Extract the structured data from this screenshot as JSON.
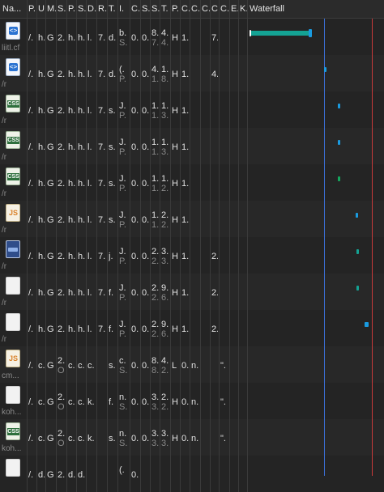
{
  "header": {
    "columns": [
      "Na...",
      "P.",
      "U.",
      "M.",
      "S.",
      "P.",
      "S.",
      "D.",
      "R.",
      "T.",
      "I.",
      "C.",
      "S.",
      "S.",
      "T.",
      "P.",
      "C.",
      "C.",
      "C.",
      "C.",
      "C.",
      "E.",
      "K."
    ],
    "waterfall_label": "Waterfall"
  },
  "colors": {
    "background": "#242424",
    "header": "#2b2b2b",
    "grid": "#3a3a3a",
    "bar_teal": "#14a394",
    "bar_blue": "#1a9be0",
    "bar_green": "#14a85e",
    "dom_content_line": "#3b6fd6",
    "load_line": "#c83a3a"
  },
  "rows": [
    {
      "icon": "html-file-icon",
      "icon_type": "html",
      "icon_glyph": "<>",
      "sub": "liitl.cf",
      "c1": "/.",
      "c2": "h.",
      "c3": "G",
      "c4": "2.",
      "c5": "h.",
      "c6": "h.",
      "c7": "l.",
      "c8": "7.",
      "c9": "d.",
      "c10a": "b.",
      "c10b": "S.",
      "c11": "0.",
      "c12": "0.",
      "c13a": "8.",
      "c13b": "7.",
      "c14a": "4.",
      "c14b": "4.",
      "c15": "H",
      "c16": "1.",
      "c17": "",
      "c18": "",
      "c19": "7.",
      "c20": "",
      "c21": ""
    },
    {
      "icon": "html-file-icon",
      "icon_type": "html",
      "icon_glyph": "<>",
      "sub": "/r",
      "c1": "/.",
      "c2": "h.",
      "c3": "G",
      "c4": "2.",
      "c5": "h.",
      "c6": "h.",
      "c7": "l.",
      "c8": "7.",
      "c9": "d.",
      "c10a": "(.",
      "c10b": "P.",
      "c11": "0.",
      "c12": "0.",
      "c13a": "4.",
      "c13b": "1.",
      "c14a": "1.",
      "c14b": "8.",
      "c15": "H",
      "c16": "1.",
      "c17": "",
      "c18": "",
      "c19": "4.",
      "c20": "",
      "c21": ""
    },
    {
      "icon": "css-file-icon",
      "icon_type": "css",
      "icon_glyph": "CSS",
      "sub": "/r",
      "c1": "/.",
      "c2": "h.",
      "c3": "G",
      "c4": "2.",
      "c5": "h.",
      "c6": "h.",
      "c7": "l.",
      "c8": "7.",
      "c9": "s.",
      "c10a": "J.",
      "c10b": "P.",
      "c11": "0.",
      "c12": "0.",
      "c13a": "1.",
      "c13b": "1.",
      "c14a": "1.",
      "c14b": "3.",
      "c15": "H",
      "c16": "1.",
      "c17": "",
      "c18": "",
      "c19": "",
      "c20": "",
      "c21": ""
    },
    {
      "icon": "css-file-icon",
      "icon_type": "css",
      "icon_glyph": "CSS",
      "sub": "/r",
      "c1": "/.",
      "c2": "h.",
      "c3": "G",
      "c4": "2.",
      "c5": "h.",
      "c6": "h.",
      "c7": "l.",
      "c8": "7.",
      "c9": "s.",
      "c10a": "J.",
      "c10b": "P.",
      "c11": "0.",
      "c12": "0.",
      "c13a": "1.",
      "c13b": "1.",
      "c14a": "1.",
      "c14b": "3.",
      "c15": "H",
      "c16": "1.",
      "c17": "",
      "c18": "",
      "c19": "",
      "c20": "",
      "c21": ""
    },
    {
      "icon": "css-file-icon",
      "icon_type": "css",
      "icon_glyph": "CSS",
      "sub": "/r",
      "c1": "/.",
      "c2": "h.",
      "c3": "G",
      "c4": "2.",
      "c5": "h.",
      "c6": "h.",
      "c7": "l.",
      "c8": "7.",
      "c9": "s.",
      "c10a": "J.",
      "c10b": "P.",
      "c11": "0.",
      "c12": "0.",
      "c13a": "1.",
      "c13b": "1.",
      "c14a": "1.",
      "c14b": "2.",
      "c15": "H",
      "c16": "1.",
      "c17": "",
      "c18": "",
      "c19": "",
      "c20": "",
      "c21": ""
    },
    {
      "icon": "js-file-icon",
      "icon_type": "js",
      "icon_glyph": "JS",
      "sub": "/r",
      "c1": "/.",
      "c2": "h.",
      "c3": "G",
      "c4": "2.",
      "c5": "h.",
      "c6": "h.",
      "c7": "l.",
      "c8": "7.",
      "c9": "s.",
      "c10a": "J.",
      "c10b": "P.",
      "c11": "0.",
      "c12": "0.",
      "c13a": "1.",
      "c13b": "1.",
      "c14a": "2.",
      "c14b": "2.",
      "c15": "H",
      "c16": "1.",
      "c17": "",
      "c18": "",
      "c19": "",
      "c20": "",
      "c21": ""
    },
    {
      "icon": "image-file-icon",
      "icon_type": "img",
      "icon_glyph": "",
      "sub": "/r",
      "c1": "/.",
      "c2": "h.",
      "c3": "G",
      "c4": "2.",
      "c5": "h.",
      "c6": "h.",
      "c7": "l.",
      "c8": "7.",
      "c9": "j.",
      "c10a": "J.",
      "c10b": "P.",
      "c11": "0.",
      "c12": "0.",
      "c13a": "2.",
      "c13b": "2.",
      "c14a": "3.",
      "c14b": "3.",
      "c15": "H",
      "c16": "1.",
      "c17": "",
      "c18": "",
      "c19": "2.",
      "c20": "",
      "c21": ""
    },
    {
      "icon": "blank-file-icon",
      "icon_type": "blank",
      "icon_glyph": "",
      "sub": "/r",
      "c1": "/.",
      "c2": "h.",
      "c3": "G",
      "c4": "2.",
      "c5": "h.",
      "c6": "h.",
      "c7": "l.",
      "c8": "7.",
      "c9": "f.",
      "c10a": "J.",
      "c10b": "P.",
      "c11": "0.",
      "c12": "0.",
      "c13a": "2.",
      "c13b": "2.",
      "c14a": "9.",
      "c14b": "6.",
      "c15": "H",
      "c16": "1.",
      "c17": "",
      "c18": "",
      "c19": "2.",
      "c20": "",
      "c21": ""
    },
    {
      "icon": "blank-file-icon",
      "icon_type": "blank",
      "icon_glyph": "",
      "sub": "/r",
      "c1": "/.",
      "c2": "h.",
      "c3": "G",
      "c4": "2.",
      "c5": "h.",
      "c6": "h.",
      "c7": "l.",
      "c8": "7.",
      "c9": "f.",
      "c10a": "J.",
      "c10b": "P.",
      "c11": "0.",
      "c12": "0.",
      "c13a": "2.",
      "c13b": "2.",
      "c14a": "9.",
      "c14b": "6.",
      "c15": "H",
      "c16": "1.",
      "c17": "",
      "c18": "",
      "c19": "2.",
      "c20": "",
      "c21": ""
    },
    {
      "icon": "js-file-icon",
      "icon_type": "js",
      "icon_glyph": "JS",
      "sub": "cm...",
      "c1": "/.",
      "c2": "c.",
      "c3": "G",
      "c4": "2.",
      "c4b": "O",
      "c5": "c.",
      "c6": "c.",
      "c7": "c.",
      "c8": "",
      "c9": "s.",
      "c10a": "c.",
      "c10b": "S.",
      "c11": "0.",
      "c12": "0.",
      "c13a": "8.",
      "c13b": "8.",
      "c14a": "4.",
      "c14b": "2.",
      "c15": "L",
      "c16": "0.",
      "c17": "n.",
      "c18": "",
      "c19": "",
      "c20": "\".",
      "c21": ""
    },
    {
      "icon": "blank-file-icon",
      "icon_type": "blank",
      "icon_glyph": "",
      "sub": "koh...",
      "c1": "/.",
      "c2": "c.",
      "c3": "G",
      "c4": "2.",
      "c4b": "O",
      "c5": "c.",
      "c6": "c.",
      "c7": "k.",
      "c8": "",
      "c9": "f.",
      "c10a": "n.",
      "c10b": "S.",
      "c11": "0.",
      "c12": "0.",
      "c13a": "3.",
      "c13b": "3.",
      "c14a": "2.",
      "c14b": "2.",
      "c15": "H",
      "c16": "0.",
      "c17": "n.",
      "c18": "",
      "c19": "",
      "c20": "\".",
      "c21": ""
    },
    {
      "icon": "css-file-icon",
      "icon_type": "css",
      "icon_glyph": "CSS",
      "sub": "koh...",
      "c1": "/.",
      "c2": "c.",
      "c3": "G",
      "c4": "2.",
      "c4b": "O",
      "c5": "c.",
      "c6": "c.",
      "c7": "k.",
      "c8": "",
      "c9": "s.",
      "c10a": "n.",
      "c10b": "S.",
      "c11": "0.",
      "c12": "0.",
      "c13a": "3.",
      "c13b": "3.",
      "c14a": "3.",
      "c14b": "3.",
      "c15": "H",
      "c16": "0.",
      "c17": "n.",
      "c18": "",
      "c19": "",
      "c20": "\".",
      "c21": ""
    },
    {
      "icon": "blank-file-icon",
      "icon_type": "blank",
      "icon_glyph": "",
      "sub": "",
      "c1": "/.",
      "c2": "d.",
      "c3": "G",
      "c4": "2.",
      "c5": "d.",
      "c6": "d.",
      "c7": "",
      "c8": "",
      "c9": "",
      "c10a": "(.",
      "c10b": "",
      "c11": "0.",
      "c12": "",
      "c13a": "",
      "c13b": "",
      "c14a": "",
      "c14b": "",
      "c15": "",
      "c16": "",
      "c17": "",
      "c18": "",
      "c19": "",
      "c20": "",
      "c21": ""
    }
  ],
  "waterfall": {
    "dom_content_fraction": 0.56,
    "load_fraction": 0.91,
    "bars": [
      {
        "start": 0.02,
        "end": 0.47,
        "color": "#14a394",
        "cap": true
      },
      {
        "start": 0.56,
        "end": 0.58,
        "color": "#1a9be0",
        "cap": false
      },
      {
        "start": 0.66,
        "end": 0.68,
        "color": "#1a9be0",
        "cap": false
      },
      {
        "start": 0.66,
        "end": 0.68,
        "color": "#1a9be0",
        "cap": false
      },
      {
        "start": 0.66,
        "end": 0.68,
        "color": "#14a85e",
        "cap": false
      },
      {
        "start": 0.79,
        "end": 0.8,
        "color": "#1a9be0",
        "cap": false
      },
      {
        "start": 0.8,
        "end": 0.81,
        "color": "#14a394",
        "cap": false
      },
      {
        "start": 0.8,
        "end": 0.81,
        "color": "#14a394",
        "cap": false
      },
      {
        "start": 0.86,
        "end": 0.89,
        "color": "#1a9be0",
        "cap": false
      },
      null,
      null,
      null,
      null
    ]
  }
}
